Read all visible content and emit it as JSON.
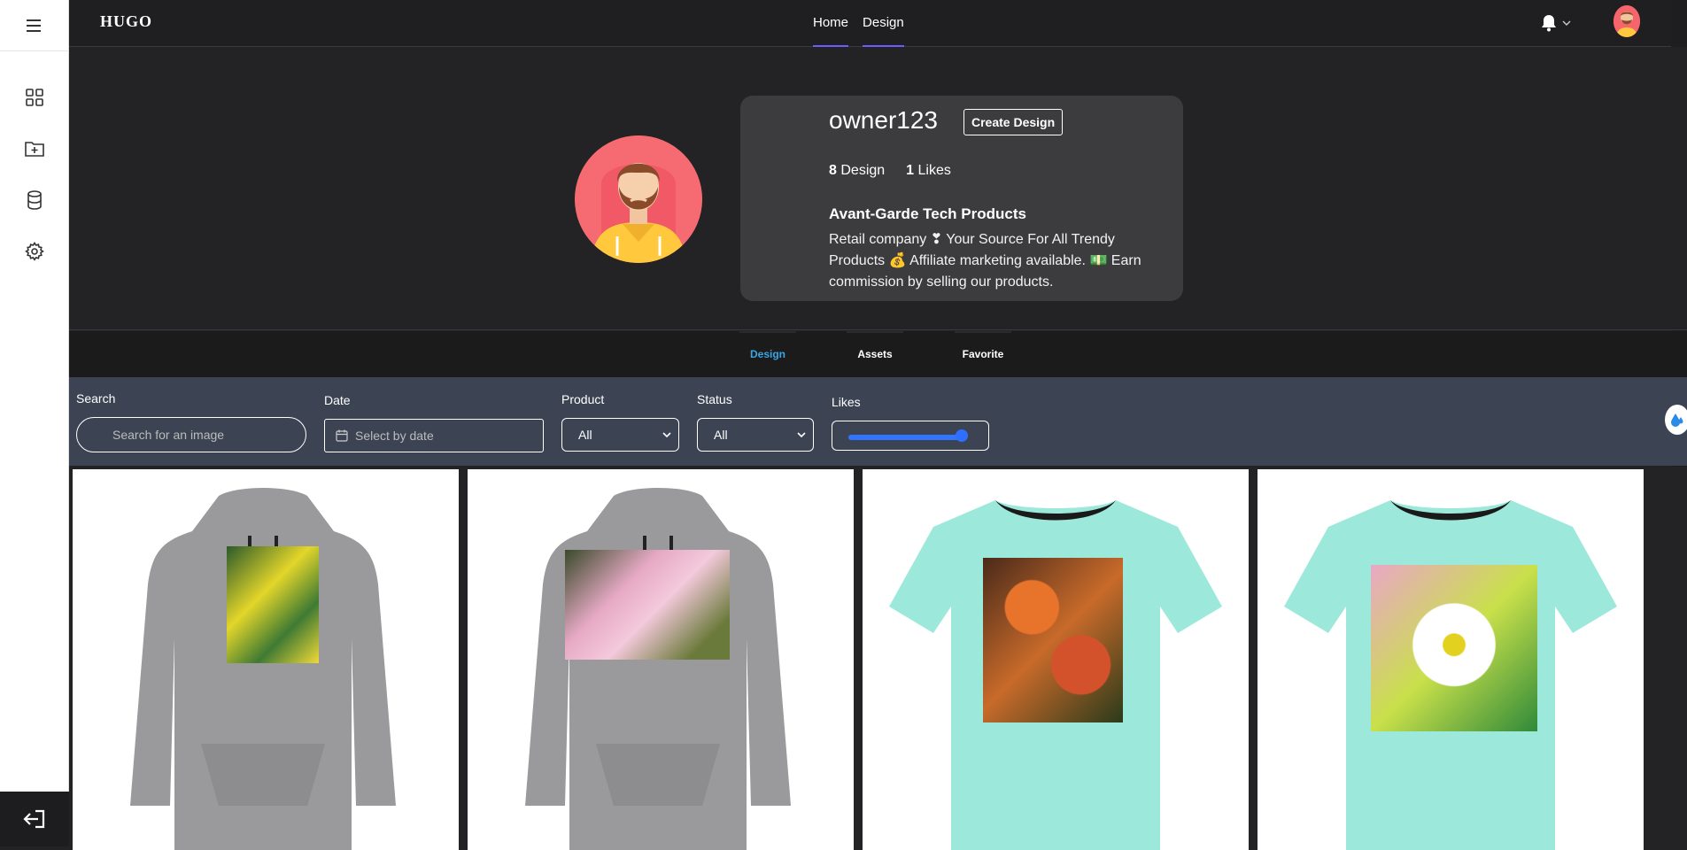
{
  "app": {
    "logo": "HUGO"
  },
  "nav": {
    "home": "Home",
    "design": "Design"
  },
  "sidebar": {
    "items": [
      {
        "icon": "menu-icon"
      },
      {
        "icon": "dashboard-grid-icon"
      },
      {
        "icon": "folder-add-icon"
      },
      {
        "icon": "database-icon"
      },
      {
        "icon": "settings-gear-icon"
      }
    ],
    "logout_icon": "logout-icon"
  },
  "profile": {
    "username": "owner123",
    "create_button": "Create Design",
    "design_count": "8",
    "design_label": "Design",
    "likes_count": "1",
    "likes_label": "Likes",
    "company": "Avant-Garde Tech Products",
    "bio_line1": "Retail company ❣ Your Source For All Trendy",
    "bio_line2": "Products 💰 Affiliate marketing available. 💵 Earn",
    "bio_line3": "commission by selling our products."
  },
  "tabs": [
    {
      "label": "Design",
      "active": true
    },
    {
      "label": "Assets",
      "active": false
    },
    {
      "label": "Favorite",
      "active": false
    }
  ],
  "filters": {
    "search_label": "Search",
    "search_placeholder": "Search for an image",
    "date_label": "Date",
    "date_placeholder": "Select by date",
    "product_label": "Product",
    "product_value": "All",
    "status_label": "Status",
    "status_value": "All",
    "likes_label": "Likes",
    "likes_slider_level": 1.0
  },
  "designs": [
    {
      "product": "hoodie",
      "print": "yellow flowers"
    },
    {
      "product": "hoodie",
      "print": "pink anemone flowers"
    },
    {
      "product": "t-shirt",
      "print": "orange chrysanthemums"
    },
    {
      "product": "t-shirt",
      "print": "white daisy"
    }
  ],
  "colors": {
    "accent": "#6a5cff",
    "tab_active": "#3aa6e5",
    "filter_bg": "#3c4454",
    "slider": "#3174ff",
    "hoodie": "#9a9a9c",
    "tee": "#9ce9dc"
  }
}
